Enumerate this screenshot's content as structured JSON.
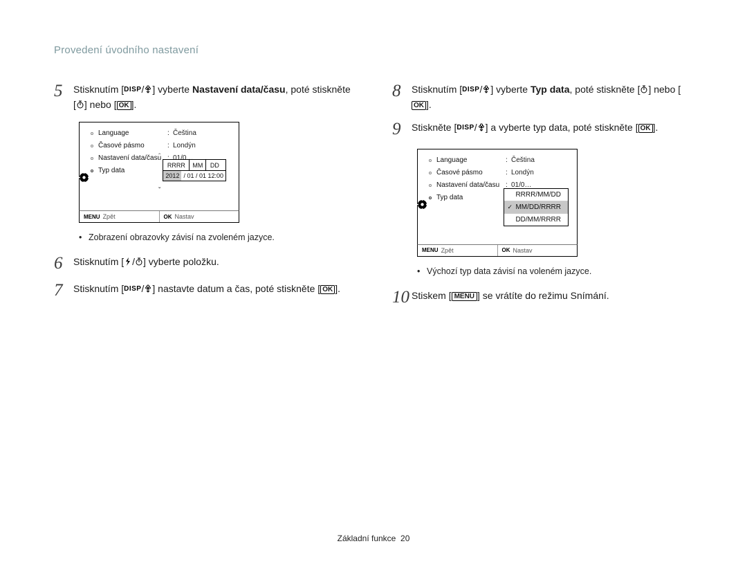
{
  "header": "Provedení úvodního nastavení",
  "left": {
    "step5": {
      "pre": "Stisknutím ",
      "mid": " vyberte ",
      "bold": "Nastavení data/času",
      "tail": ", poté stiskněte ",
      "or": " nebo ",
      "end": "."
    },
    "display1": {
      "rows": {
        "language": {
          "label": "Language",
          "value": "Čeština"
        },
        "timezone": {
          "label": "Časové pásmo",
          "value": "Londýn"
        },
        "datetime": {
          "label": "Nastavení data/času",
          "value": "01/0…"
        },
        "datatype": {
          "label": "Typ data",
          "value": ""
        }
      },
      "editHeader": {
        "c1": "RRRR",
        "c2": "MM",
        "c3": "DD"
      },
      "editValue": {
        "year": "2012",
        "rest": "/ 01 / 01 12:00"
      },
      "footer": {
        "leftKey": "MENU",
        "leftLabel": "Zpět",
        "rightKey": "OK",
        "rightLabel": "Nastav"
      }
    },
    "bullet1": "Zobrazení obrazovky závisí na zvoleném jazyce.",
    "step6": {
      "pre": "Stisknutím ",
      "tail": " vyberte položku."
    },
    "step7": {
      "pre": "Stisknutím ",
      "mid": " nastavte datum a čas, poté stiskněte ",
      "end": "."
    }
  },
  "right": {
    "step8": {
      "pre": "Stisknutím ",
      "mid": " vyberte ",
      "bold": "Typ data",
      "tail": ", poté stiskněte ",
      "or": " nebo ",
      "end": "."
    },
    "step9": {
      "pre": "Stiskněte ",
      "mid": " a vyberte typ data, poté stiskněte ",
      "end": "."
    },
    "display2": {
      "rows": {
        "language": {
          "label": "Language",
          "value": "Čeština"
        },
        "timezone": {
          "label": "Časové pásmo",
          "value": "Londýn"
        },
        "datetime": {
          "label": "Nastavení data/času",
          "value": "01/0…"
        },
        "datatype": {
          "label": "Typ data",
          "value": ""
        }
      },
      "options": {
        "a": "RRRR/MM/DD",
        "b": "MM/DD/RRRR",
        "c": "DD/MM/RRRR"
      },
      "footer": {
        "leftKey": "MENU",
        "leftLabel": "Zpět",
        "rightKey": "OK",
        "rightLabel": "Nastav"
      }
    },
    "bullet2": "Výchozí typ data závisí na voleném jazyce.",
    "step10": {
      "pre": "Stiskem ",
      "tail": " se vrátíte do režimu Snímání."
    }
  },
  "footer": {
    "section": "Základní funkce",
    "page": "20"
  },
  "icons": {
    "disp": "DISP",
    "ok": "OK",
    "menu": "MENU"
  }
}
